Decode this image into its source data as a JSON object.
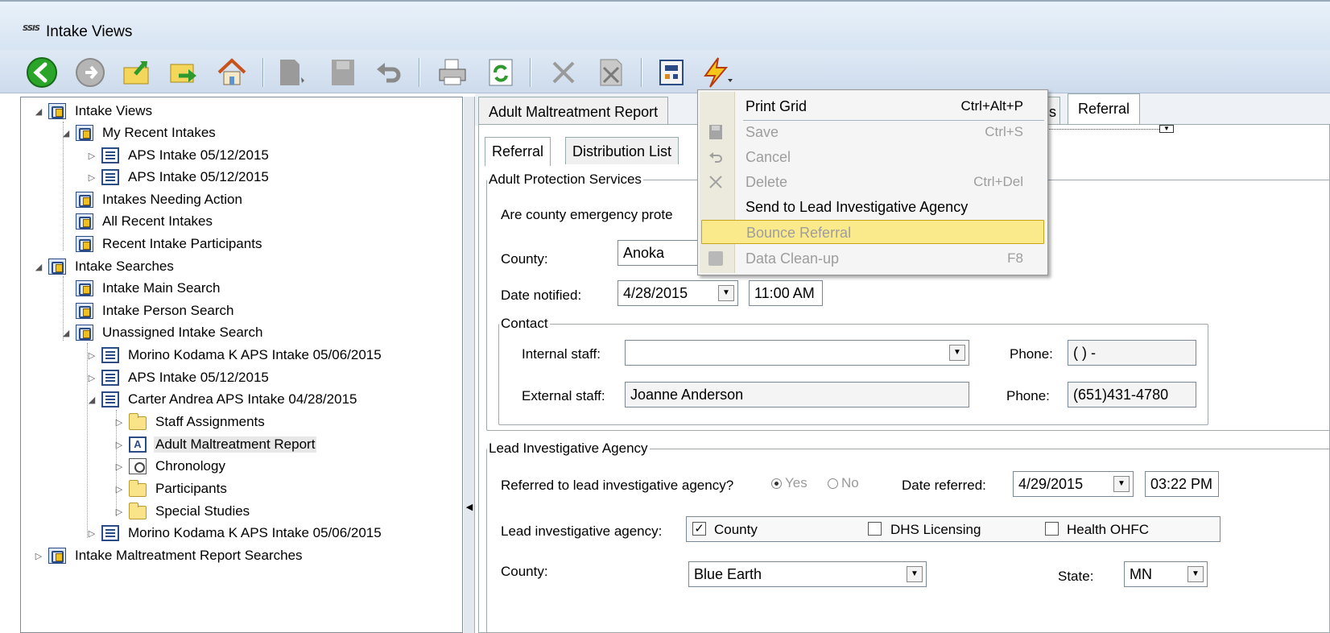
{
  "window": {
    "app_icon_text": "SSIS",
    "title": "Intake Views"
  },
  "tree": {
    "nodes": [
      "Intake Views",
      "My Recent Intakes",
      "APS Intake 05/12/2015",
      "APS Intake 05/12/2015",
      "Intakes Needing Action",
      "All Recent Intakes",
      "Recent Intake Participants",
      "Intake Searches",
      "Intake Main Search",
      "Intake Person Search",
      "Unassigned Intake Search",
      "Morino Kodama K APS Intake 05/06/2015",
      "APS Intake 05/12/2015",
      "Carter Andrea  APS Intake 04/28/2015",
      "Staff Assignments",
      "Adult Maltreatment Report",
      "Chronology",
      "Participants",
      "Special Studies",
      "Morino Kodama K APS Intake 05/06/2015",
      "Intake Maltreatment Report Searches"
    ]
  },
  "tabs": {
    "main": [
      "Adult Maltreatment Report",
      "s",
      "Referral"
    ],
    "sub": [
      "Referral",
      "Distribution List"
    ]
  },
  "aps": {
    "legend": "Adult Protection Services",
    "question": "Are county emergency prote",
    "county_label": "County:",
    "county_value": "Anoka",
    "date_label": "Date notified:",
    "date_value": "4/28/2015",
    "time_value": "11:00 AM",
    "contact": {
      "legend": "Contact",
      "internal_label": "Internal staff:",
      "internal_value": "",
      "phone_label": "Phone:",
      "internal_phone": "(  )  -",
      "external_label": "External staff:",
      "external_value": "Joanne  Anderson",
      "external_phone": "(651)431-4780"
    }
  },
  "lia": {
    "legend": "Lead Investigative Agency",
    "referred_label": "Referred to lead investigative agency?",
    "yes": "Yes",
    "no": "No",
    "date_referred_label": "Date referred:",
    "date_referred": "4/29/2015",
    "time_referred": "03:22 PM",
    "agency_label": "Lead investigative agency:",
    "opt_county": "County",
    "opt_dhs": "DHS Licensing",
    "opt_health": "Health OHFC",
    "county_label": "County:",
    "county_value": "Blue Earth",
    "state_label": "State:",
    "state_value": "MN"
  },
  "menu": {
    "items": [
      {
        "label": "Print Grid",
        "shortcut": "Ctrl+Alt+P"
      },
      {
        "label": "Save",
        "shortcut": "Ctrl+S"
      },
      {
        "label": "Cancel",
        "shortcut": ""
      },
      {
        "label": "Delete",
        "shortcut": "Ctrl+Del"
      },
      {
        "label": "Send to Lead Investigative Agency",
        "shortcut": ""
      },
      {
        "label": "Bounce Referral",
        "shortcut": ""
      },
      {
        "label": "Data Clean-up",
        "shortcut": "F8"
      }
    ]
  },
  "colors": {
    "menu_highlight": "#fbea8c",
    "toolbar_bg": "#d7e4f2",
    "back_green": "#2aa52a"
  }
}
